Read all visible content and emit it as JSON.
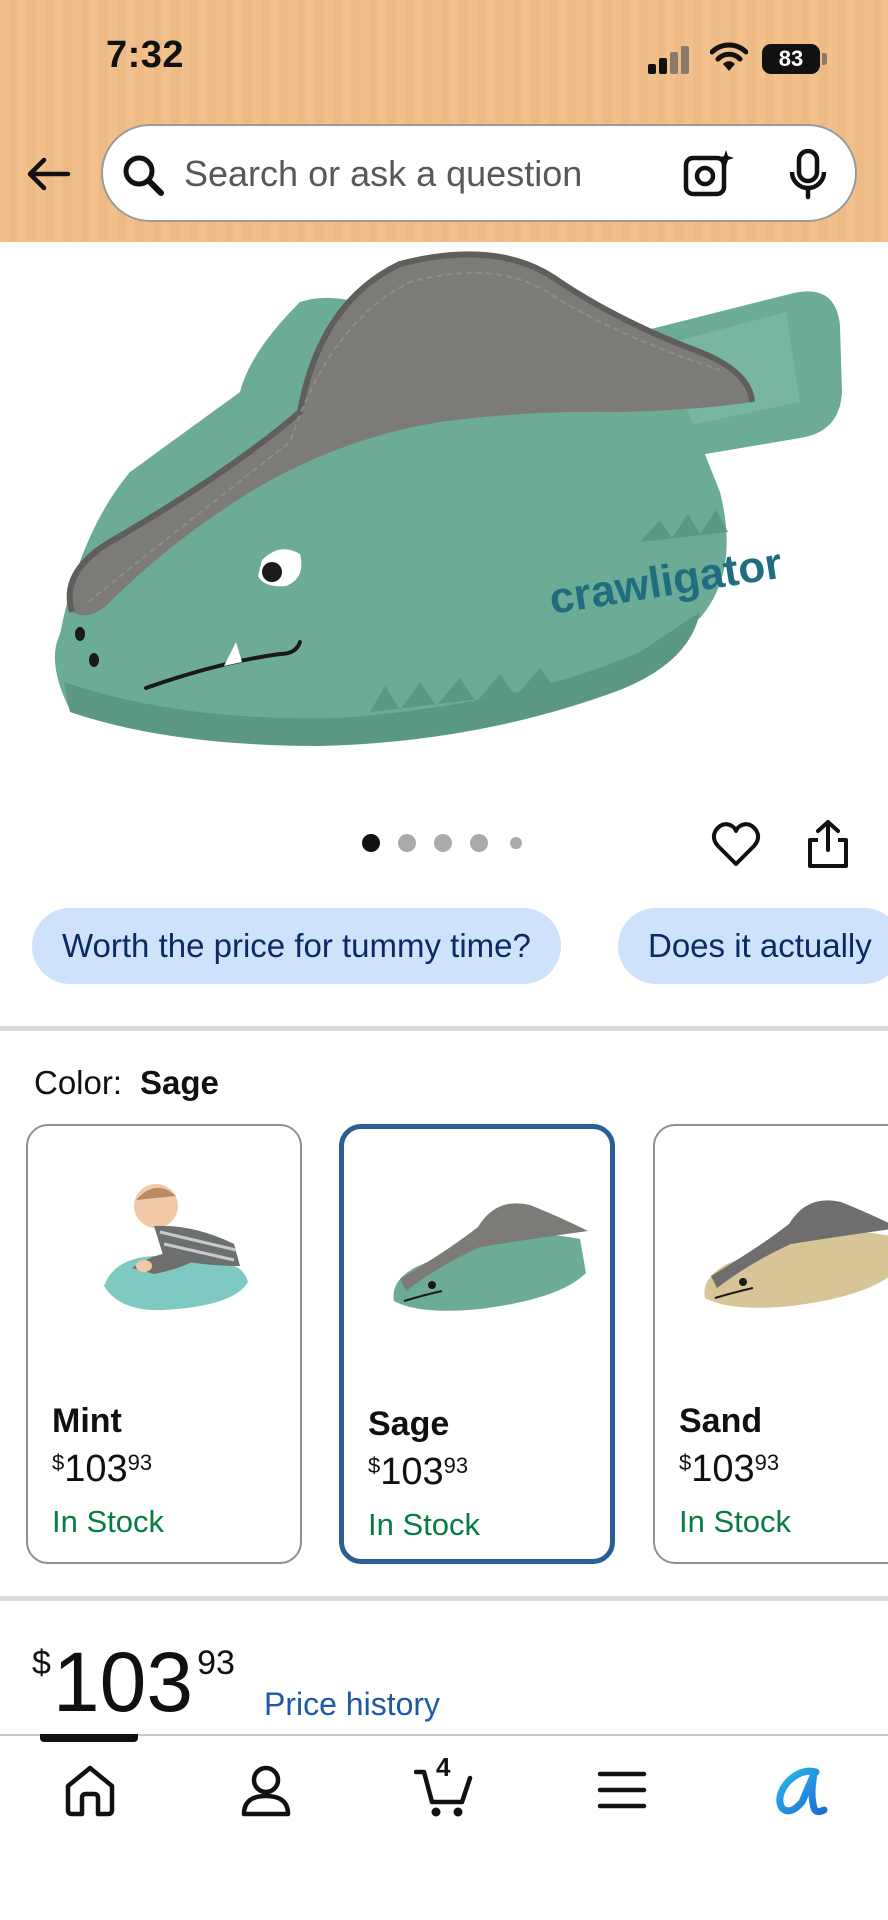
{
  "status_bar": {
    "time": "7:32",
    "battery": "83"
  },
  "search": {
    "placeholder": "Search or ask a question"
  },
  "carousel": {
    "total": 5,
    "active_index": 0
  },
  "questions": [
    "Worth the price for tummy time?",
    "Does it actually"
  ],
  "color": {
    "label": "Color:",
    "selected": "Sage",
    "options": [
      {
        "name": "Mint",
        "currency": "$",
        "whole": "103",
        "cents": "93",
        "stock": "In Stock"
      },
      {
        "name": "Sage",
        "currency": "$",
        "whole": "103",
        "cents": "93",
        "stock": "In Stock"
      },
      {
        "name": "Sand",
        "currency": "$",
        "whole": "103",
        "cents": "93",
        "stock": "In Stock"
      }
    ]
  },
  "price": {
    "currency": "$",
    "whole": "103",
    "cents": "93",
    "history_link": "Price history"
  },
  "product_brand_text": "crawligator",
  "nav": {
    "cart_count": "4",
    "items": [
      "home-icon",
      "account-icon",
      "cart-icon",
      "menu-icon",
      "rufus-icon"
    ]
  },
  "colors": {
    "header_bg": "#f2c08c",
    "chip_bg": "#cfe2fb",
    "selected_border": "#2a5e96",
    "in_stock": "#067d40",
    "link": "#1c5aa8",
    "sage": "#6cab96",
    "pad_gray": "#7d7b78",
    "sand": "#d7c597",
    "mint": "#7ec9c2"
  }
}
